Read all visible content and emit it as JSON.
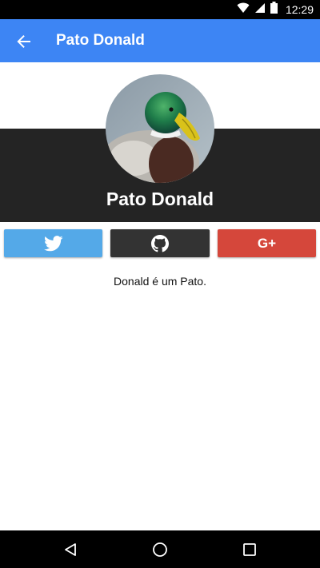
{
  "status_bar": {
    "time": "12:29",
    "icons": [
      "wifi-icon",
      "signal-icon",
      "battery-icon"
    ]
  },
  "app_bar": {
    "title": "Pato Donald",
    "back_icon": "arrow-back-icon"
  },
  "profile": {
    "name": "Pato Donald",
    "avatar": "mallard-duck-photo",
    "bio": "Donald é um Pato."
  },
  "social_buttons": [
    {
      "icon": "twitter-icon",
      "color": "#54a9e8"
    },
    {
      "icon": "github-icon",
      "color": "#333333"
    },
    {
      "icon": "google-plus-icon",
      "label": "G+",
      "color": "#d5473b"
    }
  ],
  "nav_bar": {
    "icons": [
      "back-triangle-icon",
      "home-circle-icon",
      "recents-square-icon"
    ]
  },
  "colors": {
    "app_bar": "#3d85f4",
    "profile_band": "#242424",
    "status_bar": "#000000"
  }
}
